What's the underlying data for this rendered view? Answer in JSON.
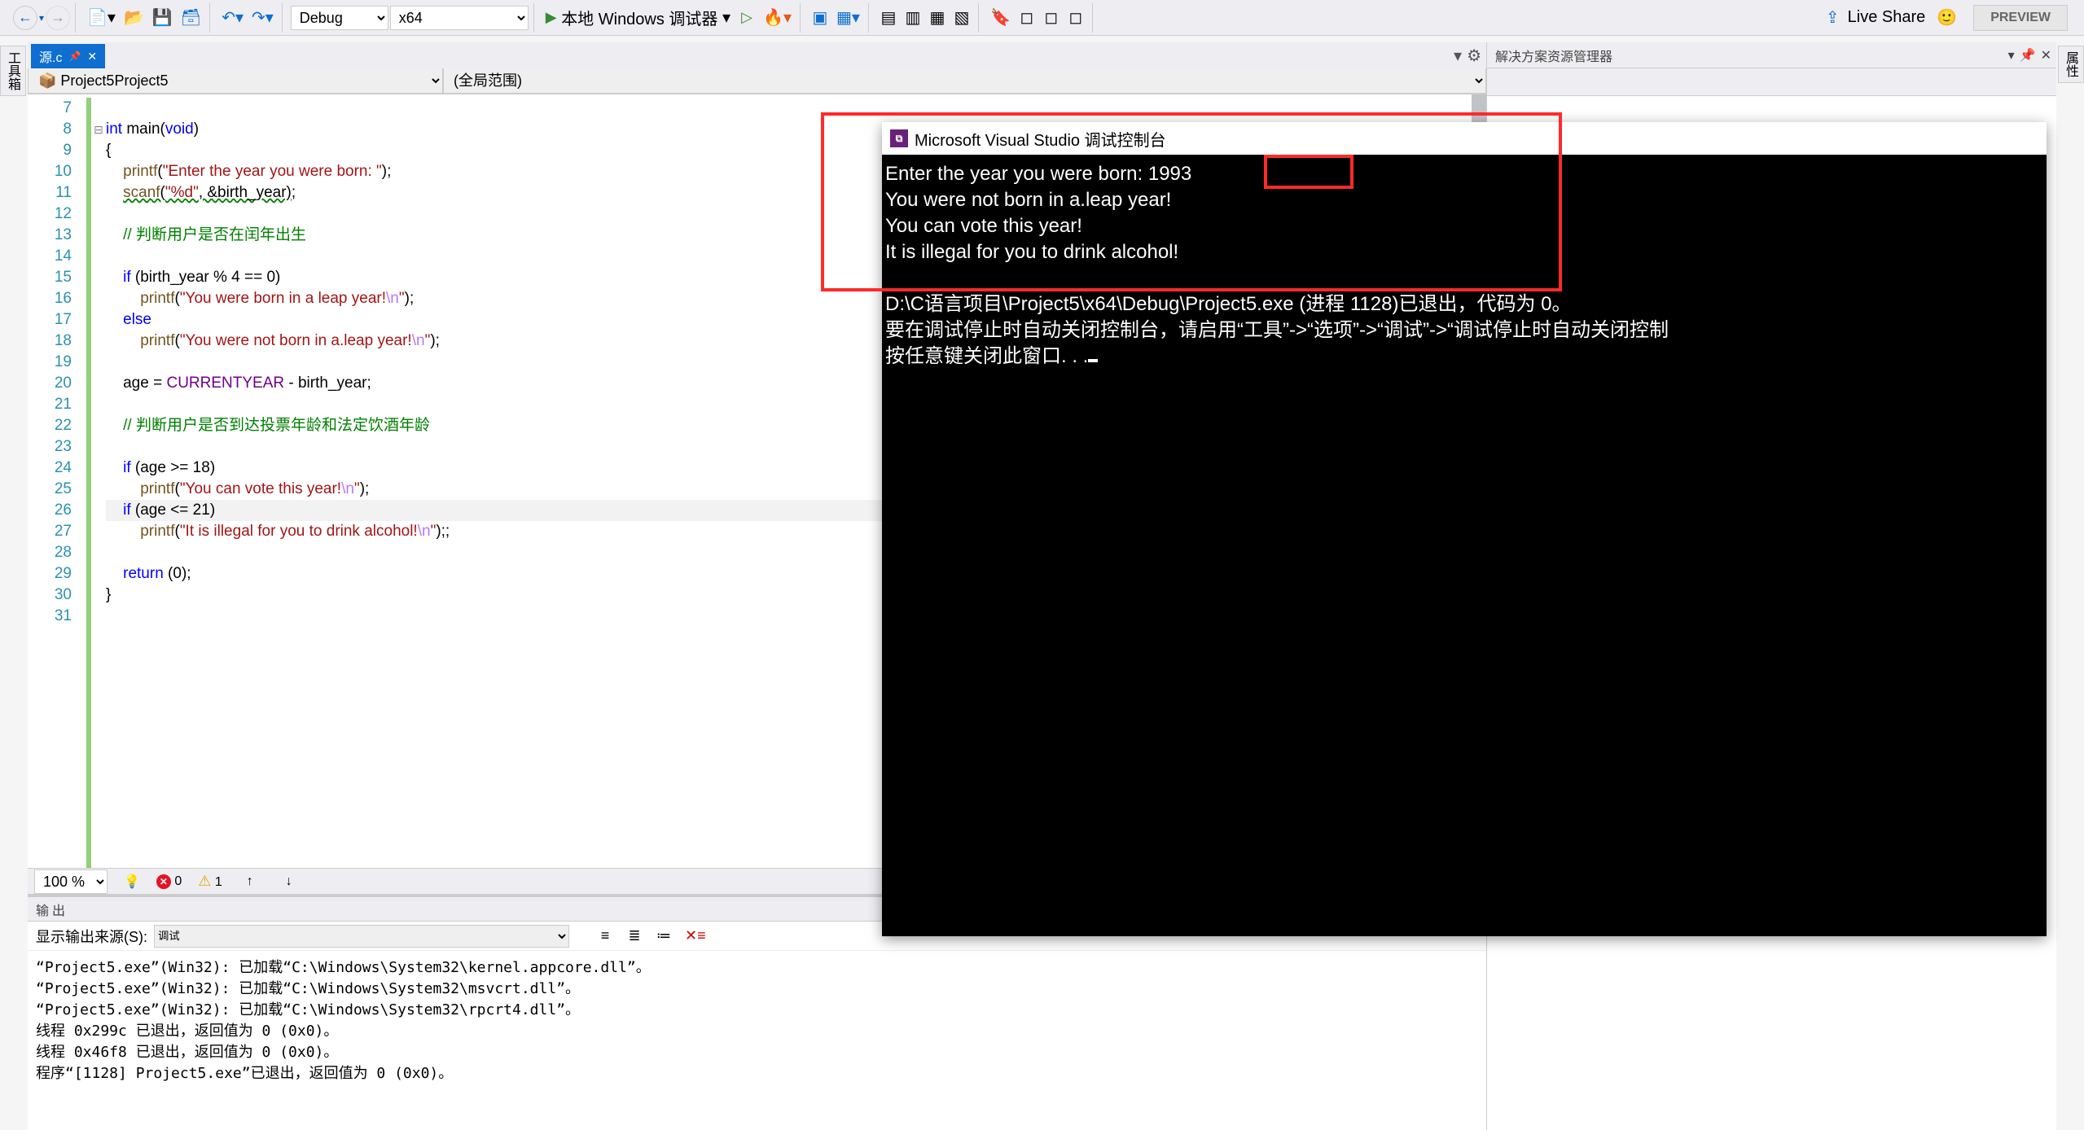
{
  "toolbar": {
    "config_select": "Debug",
    "platform_select": "x64",
    "debugger_label": "本地 Windows 调试器",
    "live_share": "Live Share",
    "preview": "PREVIEW"
  },
  "side_tabs": {
    "left": "工具箱",
    "right": "属性"
  },
  "editor": {
    "tab_name": "源.c",
    "scope_left": "Project5",
    "scope_right": "(全局范围)",
    "zoom": "100 %",
    "errors": "0",
    "warnings": "1",
    "lines": [
      {
        "n": 7,
        "html": ""
      },
      {
        "n": 8,
        "html": "<span class='kw'>int</span> <span class='fn'>main</span>(<span class='kw'>void</span>)"
      },
      {
        "n": 9,
        "html": "{"
      },
      {
        "n": 10,
        "html": "    <span class='fn-call'>printf</span>(<span class='str'>\"Enter the year you were born: \"</span>);"
      },
      {
        "n": 11,
        "html": "    <span class='fn-call wavy'>scanf</span><span class='wavy'>(</span><span class='str wavy'>\"%d\"</span><span class='wavy'>, &amp;birth_year)</span>;"
      },
      {
        "n": 12,
        "html": ""
      },
      {
        "n": 13,
        "html": "    <span class='cmt'>// 判断用户是否在闰年出生</span>"
      },
      {
        "n": 14,
        "html": ""
      },
      {
        "n": 15,
        "html": "    <span class='kw'>if</span> (birth_year % 4 == 0)"
      },
      {
        "n": 16,
        "html": "        <span class='fn-call'>printf</span>(<span class='str'>\"You were born in a leap year!</span><span class='esc'>\\n</span><span class='str'>\"</span>);"
      },
      {
        "n": 17,
        "html": "    <span class='kw'>else</span>"
      },
      {
        "n": 18,
        "html": "        <span class='fn-call'>printf</span>(<span class='str'>\"You were not born in a.leap year!</span><span class='esc'>\\n</span><span class='str'>\"</span>);"
      },
      {
        "n": 19,
        "html": ""
      },
      {
        "n": 20,
        "html": "    age = <span class='macro'>CURRENTYEAR</span> - birth_year;"
      },
      {
        "n": 21,
        "html": ""
      },
      {
        "n": 22,
        "html": "    <span class='cmt'>// 判断用户是否到达投票年龄和法定饮酒年龄</span>"
      },
      {
        "n": 23,
        "html": ""
      },
      {
        "n": 24,
        "html": "    <span class='kw'>if</span> (age &gt;= 18)"
      },
      {
        "n": 25,
        "html": "        <span class='fn-call'>printf</span>(<span class='str'>\"You can vote this year!</span><span class='esc'>\\n</span><span class='str'>\"</span>);"
      },
      {
        "n": 26,
        "html": "    <span class='kw'>if</span> (age &lt;= 21)",
        "hl": true
      },
      {
        "n": 27,
        "html": "        <span class='fn-call'>printf</span>(<span class='str'>\"It is illegal for you to drink alcohol!</span><span class='esc'>\\n</span><span class='str'>\"</span>);;"
      },
      {
        "n": 28,
        "html": ""
      },
      {
        "n": 29,
        "html": "    <span class='kw'>return</span> (0);"
      },
      {
        "n": 30,
        "html": "}"
      },
      {
        "n": 31,
        "html": ""
      }
    ]
  },
  "solution_explorer": {
    "title": "解决方案资源管理器"
  },
  "output": {
    "title": "输出",
    "source_label": "显示输出来源(S):",
    "source_value": "调试",
    "lines": [
      "“Project5.exe”(Win32): 已加载“C:\\Windows\\System32\\kernel.appcore.dll”。",
      "“Project5.exe”(Win32): 已加载“C:\\Windows\\System32\\msvcrt.dll”。",
      "“Project5.exe”(Win32): 已加载“C:\\Windows\\System32\\rpcrt4.dll”。",
      "线程 0x299c 已退出，返回值为 0 (0x0)。",
      "线程 0x46f8 已退出，返回值为 0 (0x0)。",
      "程序“[1128] Project5.exe”已退出，返回值为 0 (0x0)。"
    ]
  },
  "console": {
    "title": "Microsoft Visual Studio 调试控制台",
    "prompt": "Enter the year you were born: ",
    "input": "1993",
    "out1": "You were not born in a.leap year!",
    "out2": "You can vote this year!",
    "out3": "It is illegal for you to drink alcohol!",
    "exit": "D:\\C语言项目\\Project5\\x64\\Debug\\Project5.exe (进程 1128)已退出，代码为 0。",
    "hint1": "要在调试停止时自动关闭控制台，请启用“工具”->“选项”->“调试”->“调试停止时自动关闭控制",
    "hint2": "按任意键关闭此窗口. . ."
  }
}
